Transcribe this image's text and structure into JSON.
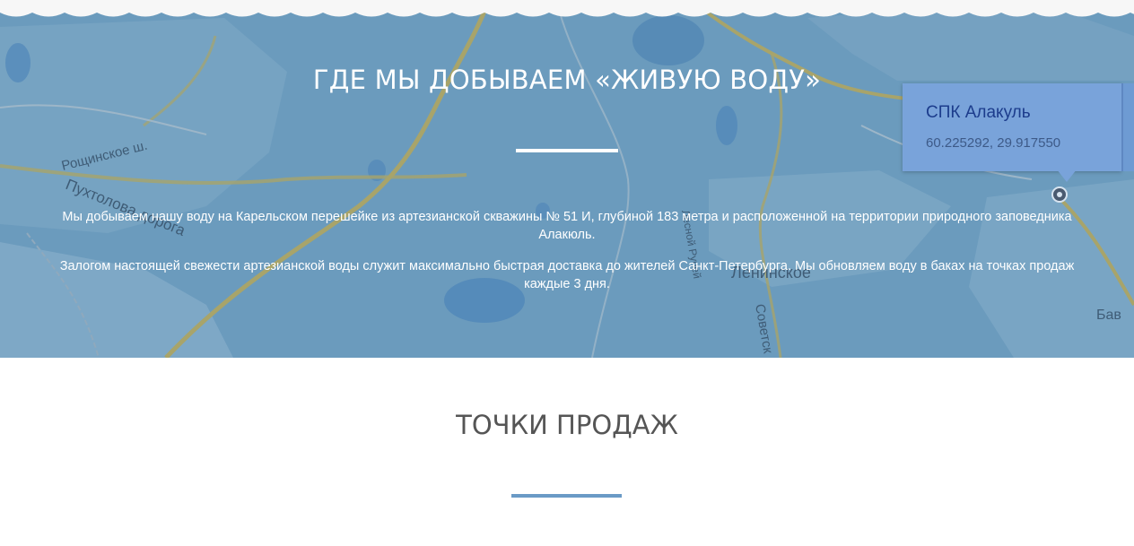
{
  "hero": {
    "title": "ГДЕ МЫ ДОБЫВАЕМ «ЖИВУЮ ВОДУ»",
    "paragraph1": "Мы добываем нашу воду на Карельском перешейке из артезианской скважины № 51 И, глубиной 183 метра и расположенной на территории природного заповедника Алакюль.",
    "paragraph2": "Залогом настоящей свежести артезианской воды служит максимально быстрая доставка до жителей Санкт-Петербурга. Мы обновляем воду в баках на точках продаж каждые 3 дня."
  },
  "map": {
    "popup_title": "СПК Алакуль",
    "popup_coords": "60.225292, 29.917550",
    "labels": {
      "roshchinskoe": "Рощинское ш.",
      "pukhtolova": "Пухтолова дорога",
      "leninskoe": "Ленинское",
      "ruchey": "Лесной Ручей",
      "sovetskaya": "Советск",
      "bav": "Бав"
    }
  },
  "sales": {
    "title": "ТОЧКИ ПРОДАЖ"
  },
  "colors": {
    "map_blue": "#6b9bbd",
    "accent_line": "#6a9ac6",
    "popup_bg": "#79a3da",
    "title_gray": "#555555"
  }
}
